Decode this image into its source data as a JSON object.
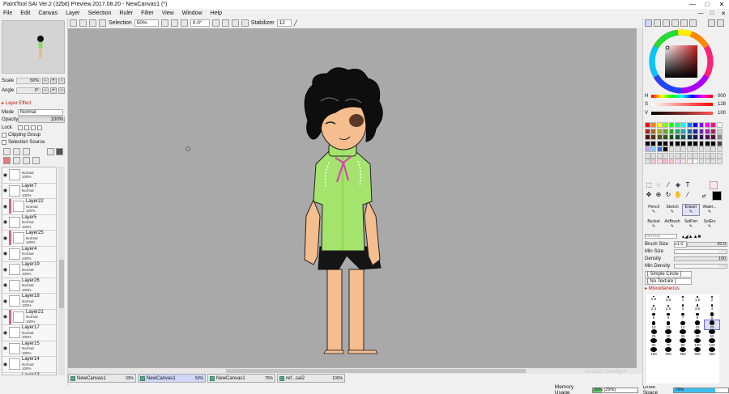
{
  "window": {
    "title": "PaintTool SAI Ver.2 (32bit) Preview.2017.08.20 - NewCanvas1 (*)",
    "controls": [
      "—",
      "□",
      "✕"
    ]
  },
  "menu": {
    "items": [
      "File",
      "Edit",
      "Canvas",
      "Layer",
      "Selection",
      "Ruler",
      "Filter",
      "View",
      "Window",
      "Help"
    ],
    "window_controls": [
      "—",
      "□",
      "✕"
    ]
  },
  "toolbar": {
    "selection_label": "Selection",
    "zoom": "50%",
    "rotation": "0.0°",
    "stabilizer_label": "Stabilizer",
    "stabilizer_value": "12"
  },
  "navigator": {
    "scale_label": "Scale",
    "scale_value": "50%",
    "angle_label": "Angle",
    "angle_value": "0°"
  },
  "layer_props": {
    "section": "Layer Effect",
    "mode_label": "Mode",
    "mode_value": "Normal",
    "opacity_label": "Opacity",
    "opacity_value": "100%",
    "lock_label": "Lock",
    "clipping_group": "Clipping Group",
    "selection_source": "Selection Source"
  },
  "layers": [
    {
      "name": "",
      "mode": "Normal",
      "opacity": "100%",
      "clip": false
    },
    {
      "name": "Layer7",
      "mode": "Normal",
      "opacity": "100%",
      "clip": false
    },
    {
      "name": "Layer22",
      "mode": "Normal",
      "opacity": "100%",
      "clip": true
    },
    {
      "name": "Layer5",
      "mode": "Normal",
      "opacity": "100%",
      "clip": false
    },
    {
      "name": "Layer25",
      "mode": "Normal",
      "opacity": "100%",
      "clip": true
    },
    {
      "name": "Layer4",
      "mode": "Normal",
      "opacity": "100%",
      "clip": false
    },
    {
      "name": "Layer19",
      "mode": "Normal",
      "opacity": "100%",
      "clip": false
    },
    {
      "name": "Layer26",
      "mode": "Normal",
      "opacity": "100%",
      "clip": false
    },
    {
      "name": "Layer18",
      "mode": "Normal",
      "opacity": "100%",
      "clip": false
    },
    {
      "name": "Layer21",
      "mode": "Normal",
      "opacity": "100%",
      "clip": true
    },
    {
      "name": "Layer17",
      "mode": "Normal",
      "opacity": "100%",
      "clip": false
    },
    {
      "name": "Layer15",
      "mode": "Normal",
      "opacity": "100%",
      "clip": false
    },
    {
      "name": "Layer14",
      "mode": "Normal",
      "opacity": "100%",
      "clip": false
    },
    {
      "name": "Layer13",
      "mode": "Normal",
      "opacity": "100%",
      "clip": false
    }
  ],
  "doc_tabs": [
    {
      "name": "NewCanvas1",
      "zoom": "33%",
      "active": false
    },
    {
      "name": "NewCanvas1",
      "zoom": "50%",
      "active": true
    },
    {
      "name": "NewCanvas1",
      "zoom": "75%",
      "active": false
    },
    {
      "name": "ref...sai2",
      "zoom": "100%",
      "active": false
    }
  ],
  "watermark": "Acesse Configur...",
  "status": {
    "memory_label": "Memory Usage",
    "memory_value": "20% (29%)",
    "memory_fraction": 0.2,
    "drive_label": "Drive Space",
    "drive_value": "76%",
    "drive_fraction": 0.76
  },
  "color": {
    "h_label": "H",
    "h_value": "000",
    "s_label": "S",
    "s_value": "128",
    "v_label": "V",
    "v_value": "100",
    "accent": "#c41e1e"
  },
  "brush_tools": [
    {
      "label": "Pencil",
      "active": false
    },
    {
      "label": "Sketch",
      "active": false
    },
    {
      "label": "Eraser",
      "active": true
    },
    {
      "label": "Water...",
      "active": false
    },
    {
      "label": "Bucket",
      "active": false
    },
    {
      "label": "AirBrush",
      "active": false
    },
    {
      "label": "SelPen",
      "active": false
    },
    {
      "label": "SelErs",
      "active": false
    }
  ],
  "brush_params": {
    "blend_mode": "Normal",
    "size_label": "Brush Size",
    "size_mult": "x1.0",
    "size_value": "20.0",
    "min_size_label": "Min Size",
    "min_size_value": "0%",
    "density_label": "Density",
    "density_value": "100",
    "min_density_label": "Min Density",
    "min_density_value": "0%",
    "shape": "[ Simple Circle ]",
    "texture": "[ No Texture ]",
    "misc_label": "Miscellaneous"
  },
  "brush_sizes": [
    "0.6",
    "0.8",
    "1",
    "1.5",
    "2",
    "2.3",
    "2.6",
    "3",
    "3.5",
    "4",
    "5",
    "6",
    "7",
    "8",
    "9",
    "10",
    "12",
    "14",
    "16",
    "20",
    "25",
    "30",
    "35",
    "40",
    "50",
    "60",
    "70",
    "80",
    "100",
    "120",
    "160",
    "200",
    "250",
    "300",
    "350"
  ],
  "selected_size": "20"
}
